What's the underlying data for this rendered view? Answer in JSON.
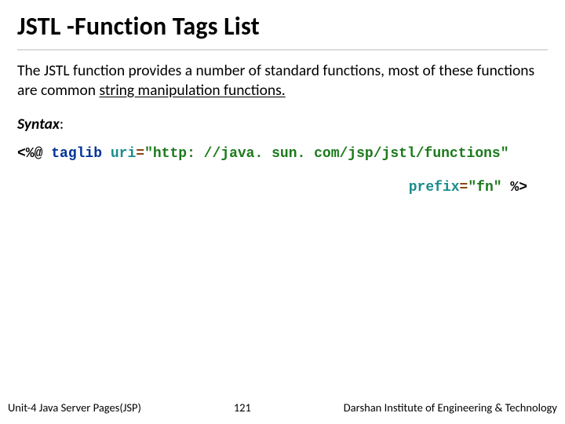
{
  "title": "JSTL -Function Tags List",
  "body": {
    "intro": "The JSTL function provides a number of standard functions, most of these functions are common ",
    "intro_underlined": "string manipulation functions."
  },
  "syntax": {
    "label": "Syntax",
    "colon": ":"
  },
  "code": {
    "open": "<%@",
    "directive": "taglib",
    "attr_uri": "uri",
    "eq1": "=",
    "uri_val": "\"http: //java. sun. com/jsp/jstl/functions\"",
    "attr_prefix": "prefix",
    "eq2": "=",
    "prefix_val": "\"fn\"",
    "close": "%>"
  },
  "footer": {
    "left": "Unit-4 Java Server Pages(JSP)",
    "page": "121",
    "right": "Darshan Institute of Engineering & Technology"
  }
}
